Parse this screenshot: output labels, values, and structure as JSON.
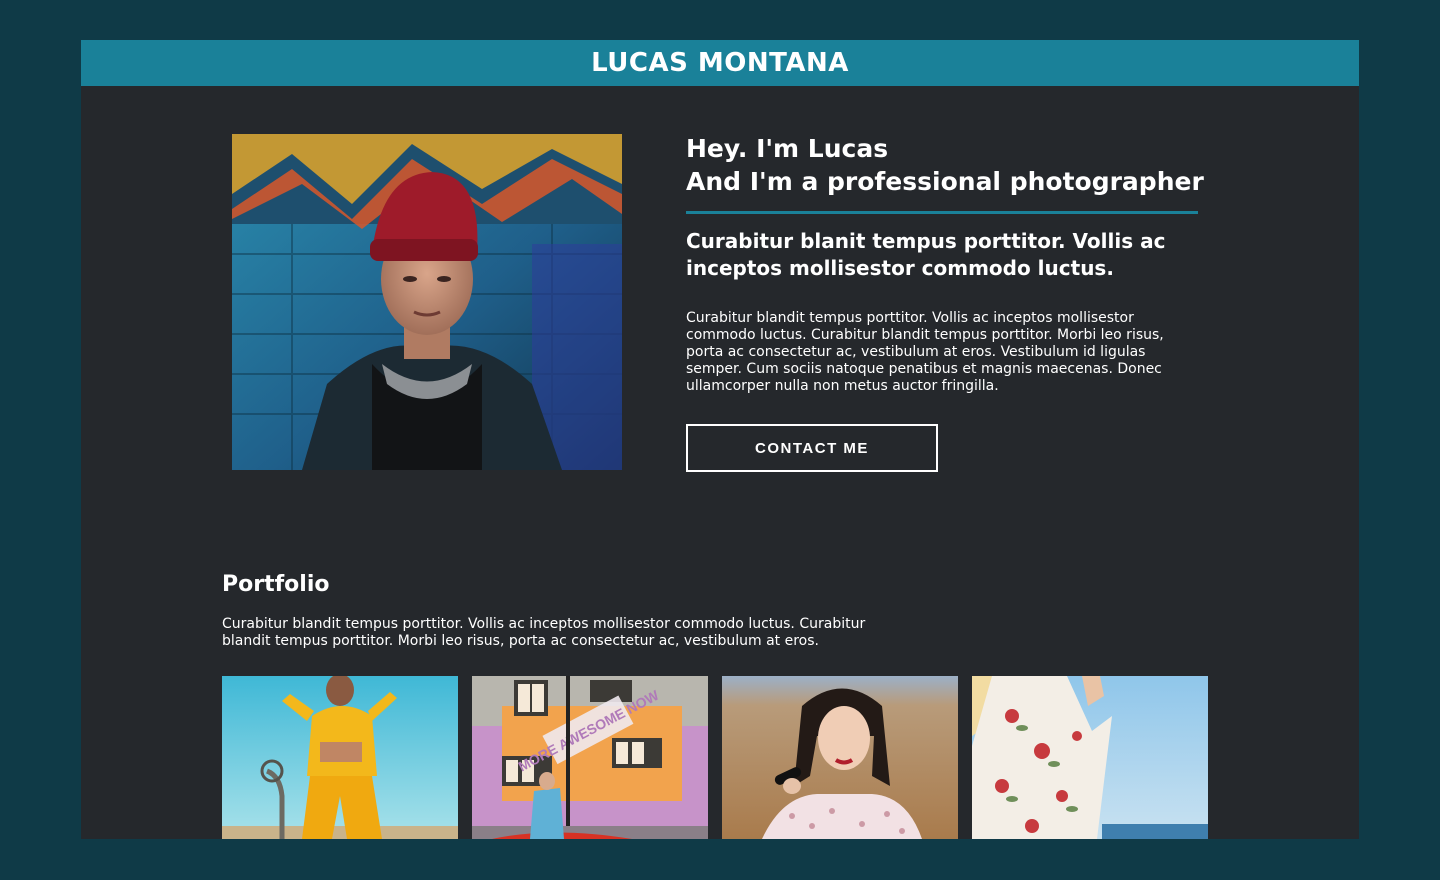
{
  "header": {
    "site_title": "LUCAS MONTANA"
  },
  "hero": {
    "heading_line_1": "Hey. I'm Lucas",
    "heading_line_2": "And I'm a professional photographer",
    "subheading": "Curabitur blanit tempus porttitor. Vollis ac inceptos mollisestor commodo luctus.",
    "body": "Curabitur blandit tempus porttitor. Vollis ac inceptos mollisestor commodo luctus. Curabitur blandit tempus porttitor. Morbi leo risus, porta ac consectetur ac, vestibulum at eros. Vestibulum id ligulas semper. Cum sociis natoque penatibus et magnis maecenas. Donec ullamcorper nulla non metus auctor fringilla.",
    "contact_button": "CONTACT ME",
    "photo_wall_text": "MORE AWESOME NOW"
  },
  "portfolio": {
    "title": "Portfolio",
    "description": "Curabitur blandit tempus porttitor. Vollis ac inceptos mollisestor commodo luctus. Curabitur blandit tempus porttitor. Morbi leo risus, porta ac consectetur ac, vestibulum at eros."
  },
  "colors": {
    "background": "#0f3a47",
    "panel": "#25282c",
    "accent": "#1a8199",
    "text": "#ffffff"
  }
}
